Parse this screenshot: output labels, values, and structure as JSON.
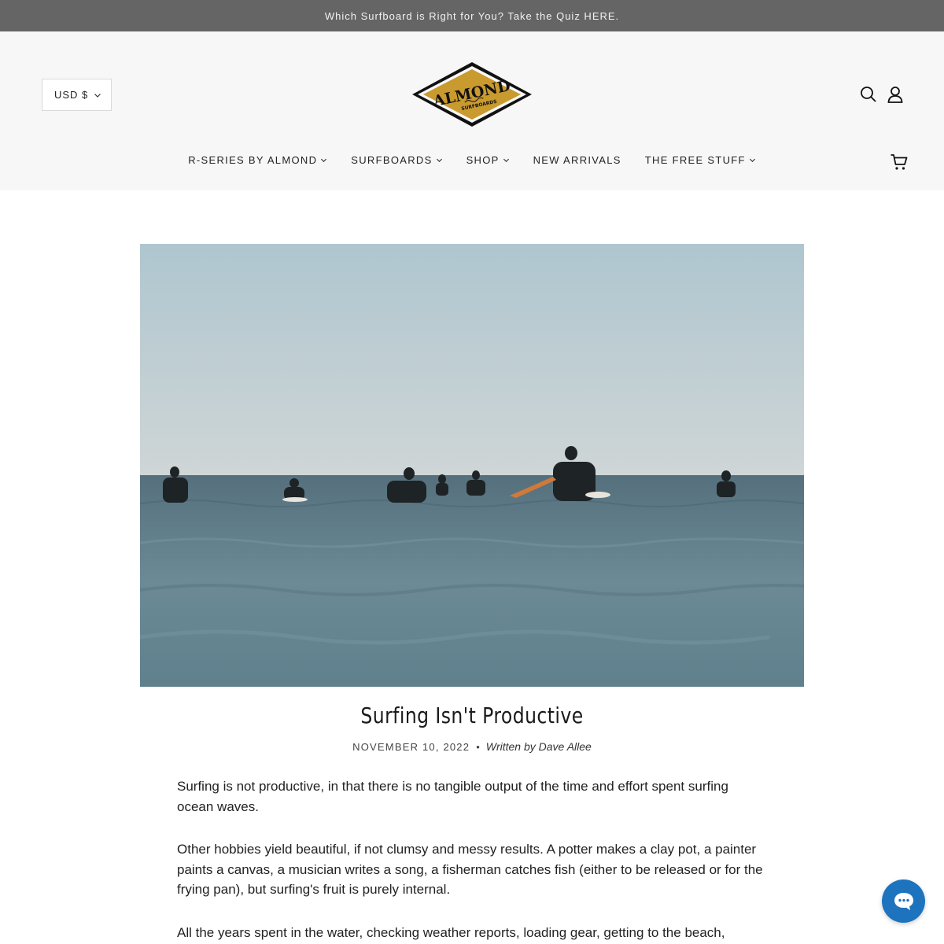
{
  "announcement": "Which Surfboard is Right for You? Take the Quiz HERE.",
  "currency": "USD $",
  "logo": {
    "text_main": "ALMOND",
    "text_sub": "SURFBOARDS",
    "color": "#c99a2e"
  },
  "nav": {
    "items": [
      {
        "label": "R-SERIES BY ALMOND",
        "has_dropdown": true
      },
      {
        "label": "SURFBOARDS",
        "has_dropdown": true
      },
      {
        "label": "SHOP",
        "has_dropdown": true
      },
      {
        "label": "NEW ARRIVALS",
        "has_dropdown": false
      },
      {
        "label": "THE FREE STUFF",
        "has_dropdown": true
      }
    ]
  },
  "icons": {
    "search": "search-icon",
    "account": "account-icon",
    "cart": "cart-icon",
    "chat": "chat-icon"
  },
  "article": {
    "title": "Surfing Isn't Productive",
    "date": "NOVEMBER 10, 2022",
    "separator": "•",
    "author": "Written by Dave Allee",
    "paragraphs": [
      "Surfing is not productive, in that there is no tangible output of the time and effort spent surfing ocean waves.",
      "Other hobbies yield beautiful, if not clumsy and messy results. A potter makes a clay pot, a painter paints a canvas, a musician writes a song, a fisherman catches fish (either to be released or for the frying pan), but surfing's fruit is purely internal.",
      "All the years spent in the water, checking weather reports, loading gear, getting to the beach,"
    ]
  },
  "colors": {
    "announce_bg": "#656565",
    "chat_bg": "#1e73be"
  }
}
